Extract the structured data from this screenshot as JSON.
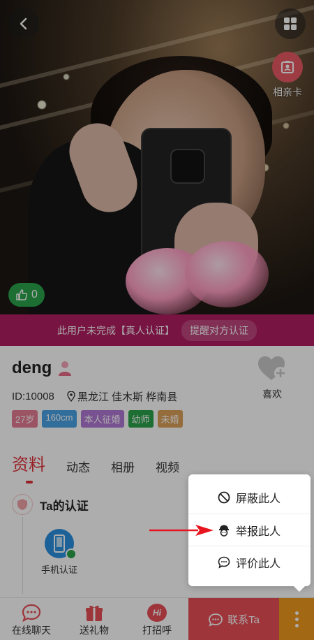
{
  "hero": {
    "card_label": "相亲卡",
    "like_count": "0"
  },
  "banner": {
    "text": "此用户未完成【真人认证】",
    "remind_label": "提醒对方认证"
  },
  "profile": {
    "name": "deng",
    "id": "ID:10008",
    "location": "黑龙江 佳木斯 桦南县",
    "favorite_label": "喜欢",
    "tags": [
      {
        "label": "27岁",
        "color": "#e57c94"
      },
      {
        "label": "160cm",
        "color": "#4aa3e6"
      },
      {
        "label": "本人征婚",
        "color": "#b278d6"
      },
      {
        "label": "幼师",
        "color": "#2aa24a"
      },
      {
        "label": "未婚",
        "color": "#dca15a"
      }
    ]
  },
  "tabs": [
    "资料",
    "动态",
    "相册",
    "视频"
  ],
  "certification": {
    "title": "Ta的认证",
    "items": [
      {
        "label": "手机认证"
      }
    ]
  },
  "bottom_bar": {
    "chat": "在线聊天",
    "gift": "送礼物",
    "greet": "打招呼",
    "contact": "联系Ta",
    "greet_icon_text": "Hi"
  },
  "menu": {
    "items": [
      {
        "label": "屏蔽此人",
        "icon": "block-icon"
      },
      {
        "label": "举报此人",
        "icon": "report-icon"
      },
      {
        "label": "评价此人",
        "icon": "comment-icon"
      }
    ]
  },
  "colors": {
    "accent_red": "#e0323c",
    "banner": "#b01e62",
    "contact": "#e84e58",
    "more": "#f09a1d",
    "arrow": "#e8141e"
  }
}
